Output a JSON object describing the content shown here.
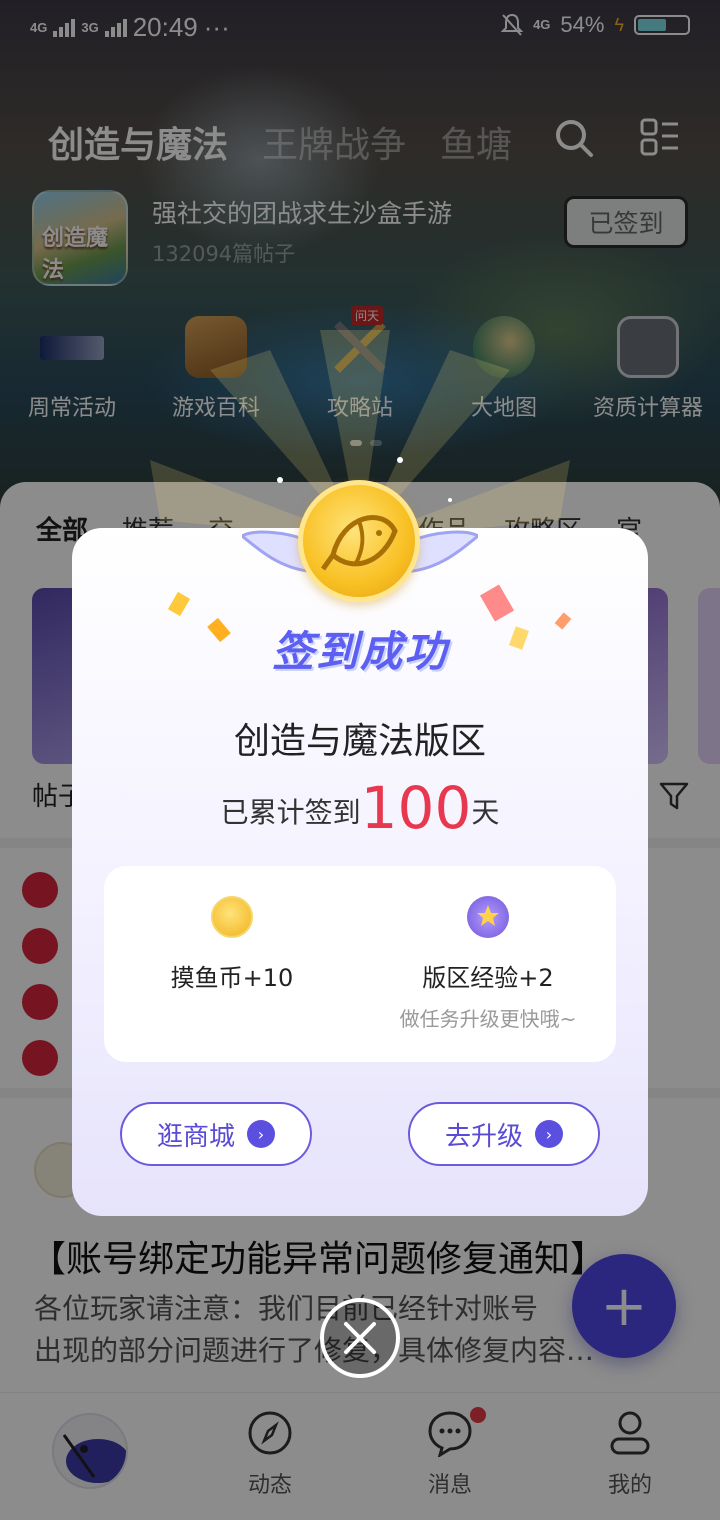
{
  "status_bar": {
    "network_left": "4G",
    "network_right": "3G",
    "time": "20:49",
    "more": "···",
    "net_right": "4G",
    "battery": "54%"
  },
  "top_nav": {
    "tabs": [
      "创造与魔法",
      "王牌战争",
      "鱼塘"
    ]
  },
  "game": {
    "tagline": "强社交的团战求生沙盒手游",
    "posts": "132094篇帖子",
    "checkin_label": "已签到",
    "thumb_text": "创造魔法"
  },
  "quick_links": [
    "周常活动",
    "游戏百科",
    "攻略站",
    "大地图",
    "资质计算器"
  ],
  "quick_badge": "问天",
  "content_tabs": [
    "全部",
    "推荐",
    "交",
    "作品",
    "攻略区",
    "官"
  ],
  "content": {
    "sub_label": "帖子",
    "post_title": "【账号绑定功能异常问题修复通知】",
    "post_body_1": "各位玩家请注意：我们目前已经针对账号",
    "post_body_2": "出现的部分问题进行了修复，具体修复内容…"
  },
  "bottom_nav": [
    "动态",
    "消息",
    "我的"
  ],
  "dialog": {
    "title": "签到成功",
    "board": "创造与魔法版区",
    "streak_prefix": "已累计签到",
    "streak_days": "100",
    "streak_suffix": "天",
    "reward_coins": "摸鱼币+10",
    "reward_exp": "版区经验+2",
    "reward_hint": "做任务升级更快哦~",
    "btn_shop": "逛商城",
    "btn_upgrade": "去升级"
  },
  "fab_label": "+",
  "colors": {
    "accent": "#5d5ef2",
    "streak": "#e8384f",
    "fab": "#4f46e5",
    "coin": "#f8c023"
  }
}
